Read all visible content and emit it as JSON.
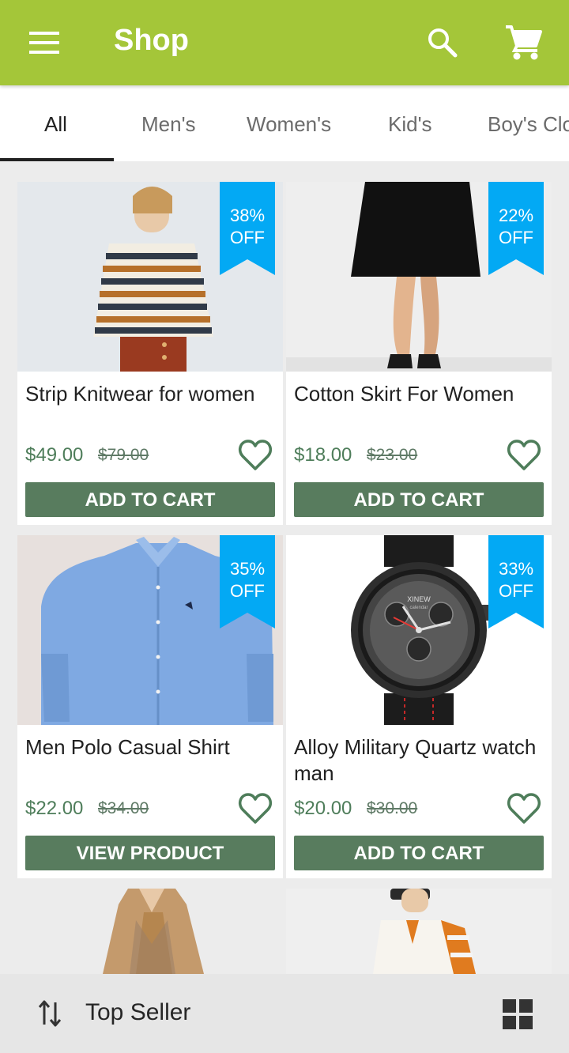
{
  "app": {
    "title": "Shop"
  },
  "tabs": [
    "All",
    "Men's",
    "Women's",
    "Kid's",
    "Boy's Clothing"
  ],
  "products": [
    {
      "name": "Strip Knitwear for women",
      "price": "$49.00",
      "old_price": "$79.00",
      "discount": "38%",
      "off": "OFF",
      "button": "ADD TO CART",
      "image": "striped-sweater-photo"
    },
    {
      "name": "Cotton Skirt For Women",
      "price": "$18.00",
      "old_price": "$23.00",
      "discount": "22%",
      "off": "OFF",
      "button": "ADD TO CART",
      "image": "black-skirt-photo"
    },
    {
      "name": "Men Polo Casual Shirt",
      "price": "$22.00",
      "old_price": "$34.00",
      "discount": "35%",
      "off": "OFF",
      "button": "VIEW PRODUCT",
      "image": "blue-shirt-photo"
    },
    {
      "name": "Alloy Military Quartz watch man",
      "price": "$20.00",
      "old_price": "$30.00",
      "discount": "33%",
      "off": "OFF",
      "button": "ADD TO CART",
      "image": "watch-photo",
      "watch_brand": "XINEW",
      "watch_sub": "calendar"
    }
  ],
  "bottom_bar": {
    "sort_label": "Top Seller"
  },
  "colors": {
    "app_bar": "#a4c639",
    "button": "#587c5e",
    "ribbon": "#03a9f4",
    "price": "#4e7d5a"
  },
  "icons": [
    "menu-icon",
    "search-icon",
    "cart-icon",
    "heart-icon",
    "sort-icon",
    "grid-view-icon"
  ]
}
